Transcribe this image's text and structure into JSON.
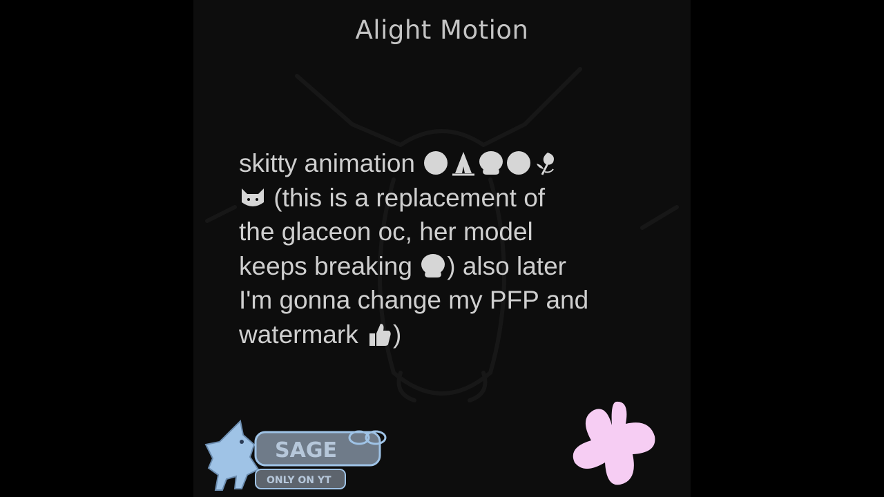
{
  "watermark": {
    "app_name": "Alight Motion"
  },
  "caption": {
    "lines": [
      {
        "text_before": "skitty animation ",
        "emojis_after": [
          "white-circle",
          "folded-hands",
          "speech-bubble",
          "white-circle",
          "wilted-flower"
        ]
      },
      {
        "text_after": " (this is a replacement of",
        "emojis_before": [
          "cat-face"
        ]
      },
      {
        "text": "the glaceon oc, her model"
      },
      {
        "text_before": "keeps breaking ",
        "emojis_mid": [
          "speech-bubble"
        ],
        "text_after": ") also later"
      },
      {
        "text": "I'm gonna change my PFP and"
      },
      {
        "text_before": "watermark ",
        "emojis_mid": [
          "thumbs-up"
        ],
        "text_after": ")"
      }
    ]
  },
  "logo_stamp": {
    "name": "SAGE",
    "tagline": "ONLY ON YT"
  },
  "colors": {
    "background": "#000000",
    "video_background": "#0d0d0d",
    "text": "#cfcfcf",
    "watermark_text": "#c4c4c4",
    "sticker_pink": "#f6cdf3",
    "logo_blue": "#9fc3e6"
  }
}
